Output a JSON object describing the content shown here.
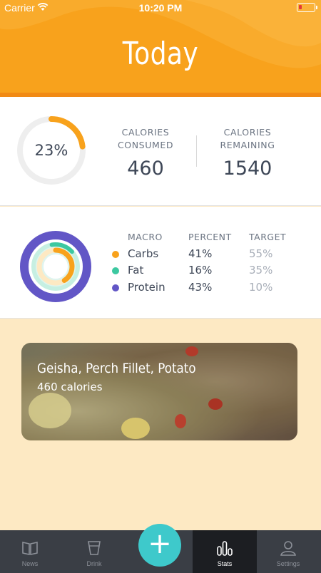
{
  "status_bar": {
    "carrier": "Carrier",
    "time": "10:20 PM"
  },
  "header": {
    "title": "Today"
  },
  "calories": {
    "ring_label": "23%",
    "ring_fraction": 0.23,
    "consumed_label": "CALORIES CONSUMED",
    "consumed_value": "460",
    "remaining_label": "CALORIES REMAINING",
    "remaining_value": "1540"
  },
  "macros": {
    "headers": {
      "macro": "MACRO",
      "percent": "PERCENT",
      "target": "TARGET"
    },
    "rows": [
      {
        "name": "Carbs",
        "percent": "41%",
        "target": "55%",
        "color": "#f8a21c"
      },
      {
        "name": "Fat",
        "percent": "16%",
        "target": "35%",
        "color": "#3cc8a0"
      },
      {
        "name": "Protein",
        "percent": "43%",
        "target": "10%",
        "color": "#6256c6"
      }
    ]
  },
  "meal": {
    "title": "Geisha, Perch Fillet, Potato",
    "calories": "460 calories"
  },
  "tabs": [
    {
      "label": "News",
      "icon": "book-icon",
      "active": false
    },
    {
      "label": "Drink",
      "icon": "glass-icon",
      "active": false
    },
    {
      "label": "Stats",
      "icon": "bar-chart-icon",
      "active": true
    },
    {
      "label": "Settings",
      "icon": "person-icon",
      "active": false
    }
  ],
  "add_button": {
    "icon": "plus-icon"
  },
  "colors": {
    "accent": "#f8a21c",
    "teal": "#3ec9cb",
    "tabbar": "#3a3e45"
  }
}
